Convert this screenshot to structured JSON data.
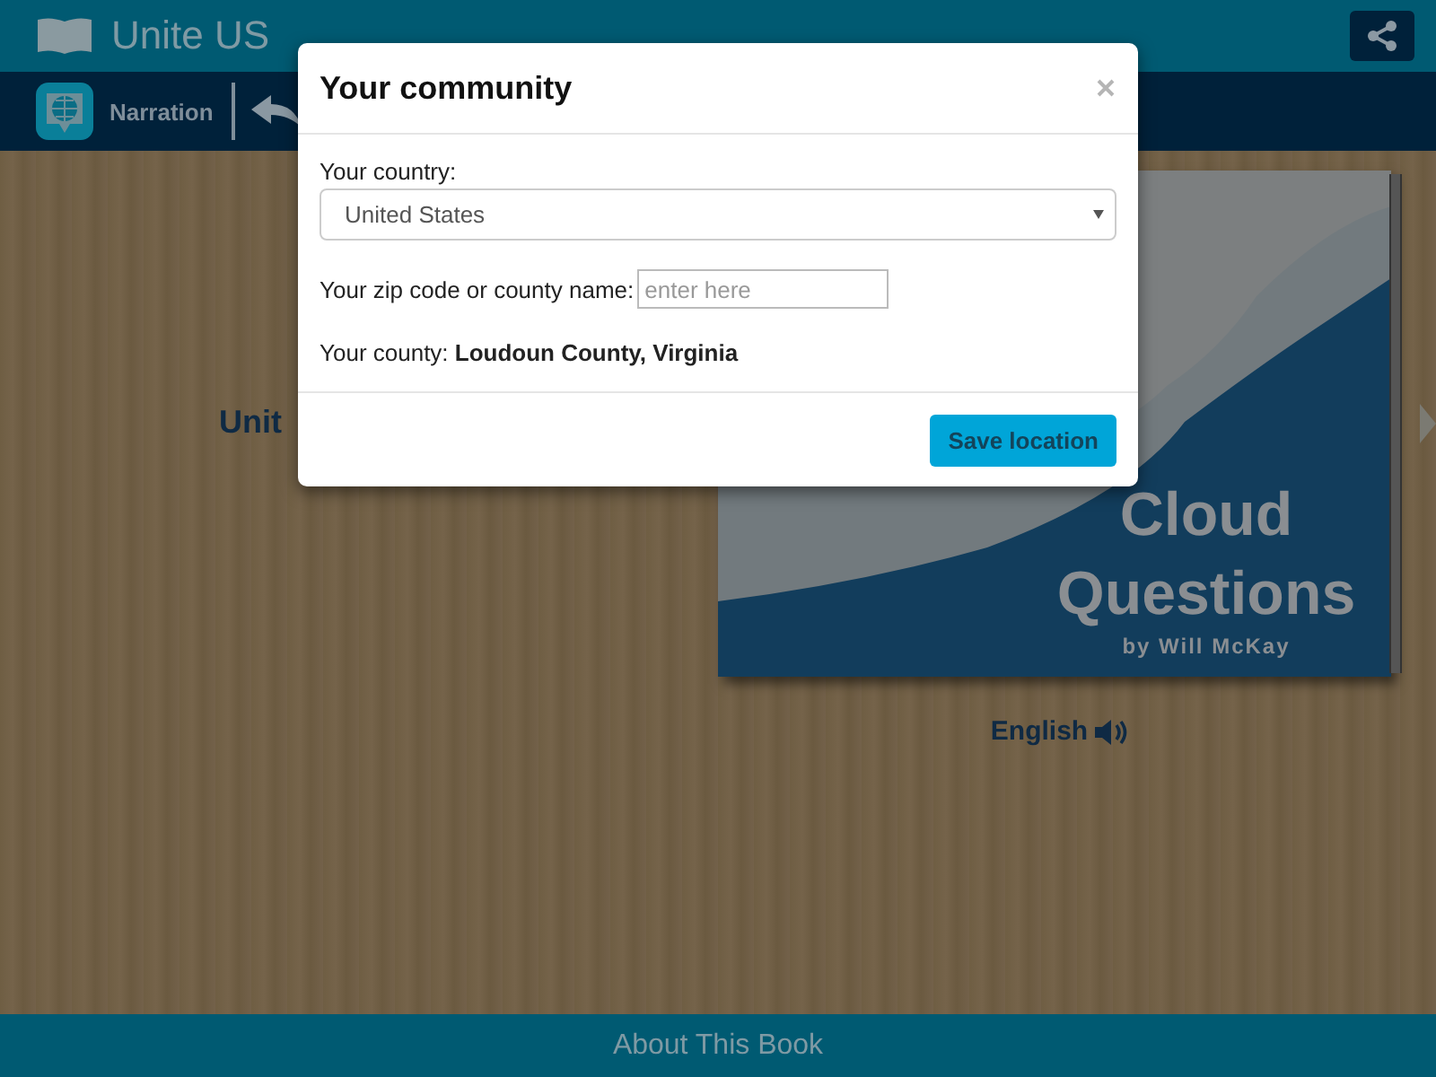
{
  "app": {
    "title": "Unite US"
  },
  "toolbar": {
    "narration_label": "Narration"
  },
  "book": {
    "partial_title": "Unit",
    "cover_title": "Cloud Questions",
    "cover_author": "by Will McKay",
    "language": "English"
  },
  "dialog": {
    "title": "Your community",
    "country_label": "Your country:",
    "country_value": "United States",
    "zip_label": "Your zip code or county name:",
    "zip_placeholder": "enter here",
    "county_label": "Your county:",
    "county_value": "Loudoun County, Virginia",
    "save_button": "Save location"
  },
  "footer": {
    "label": "About This Book"
  }
}
